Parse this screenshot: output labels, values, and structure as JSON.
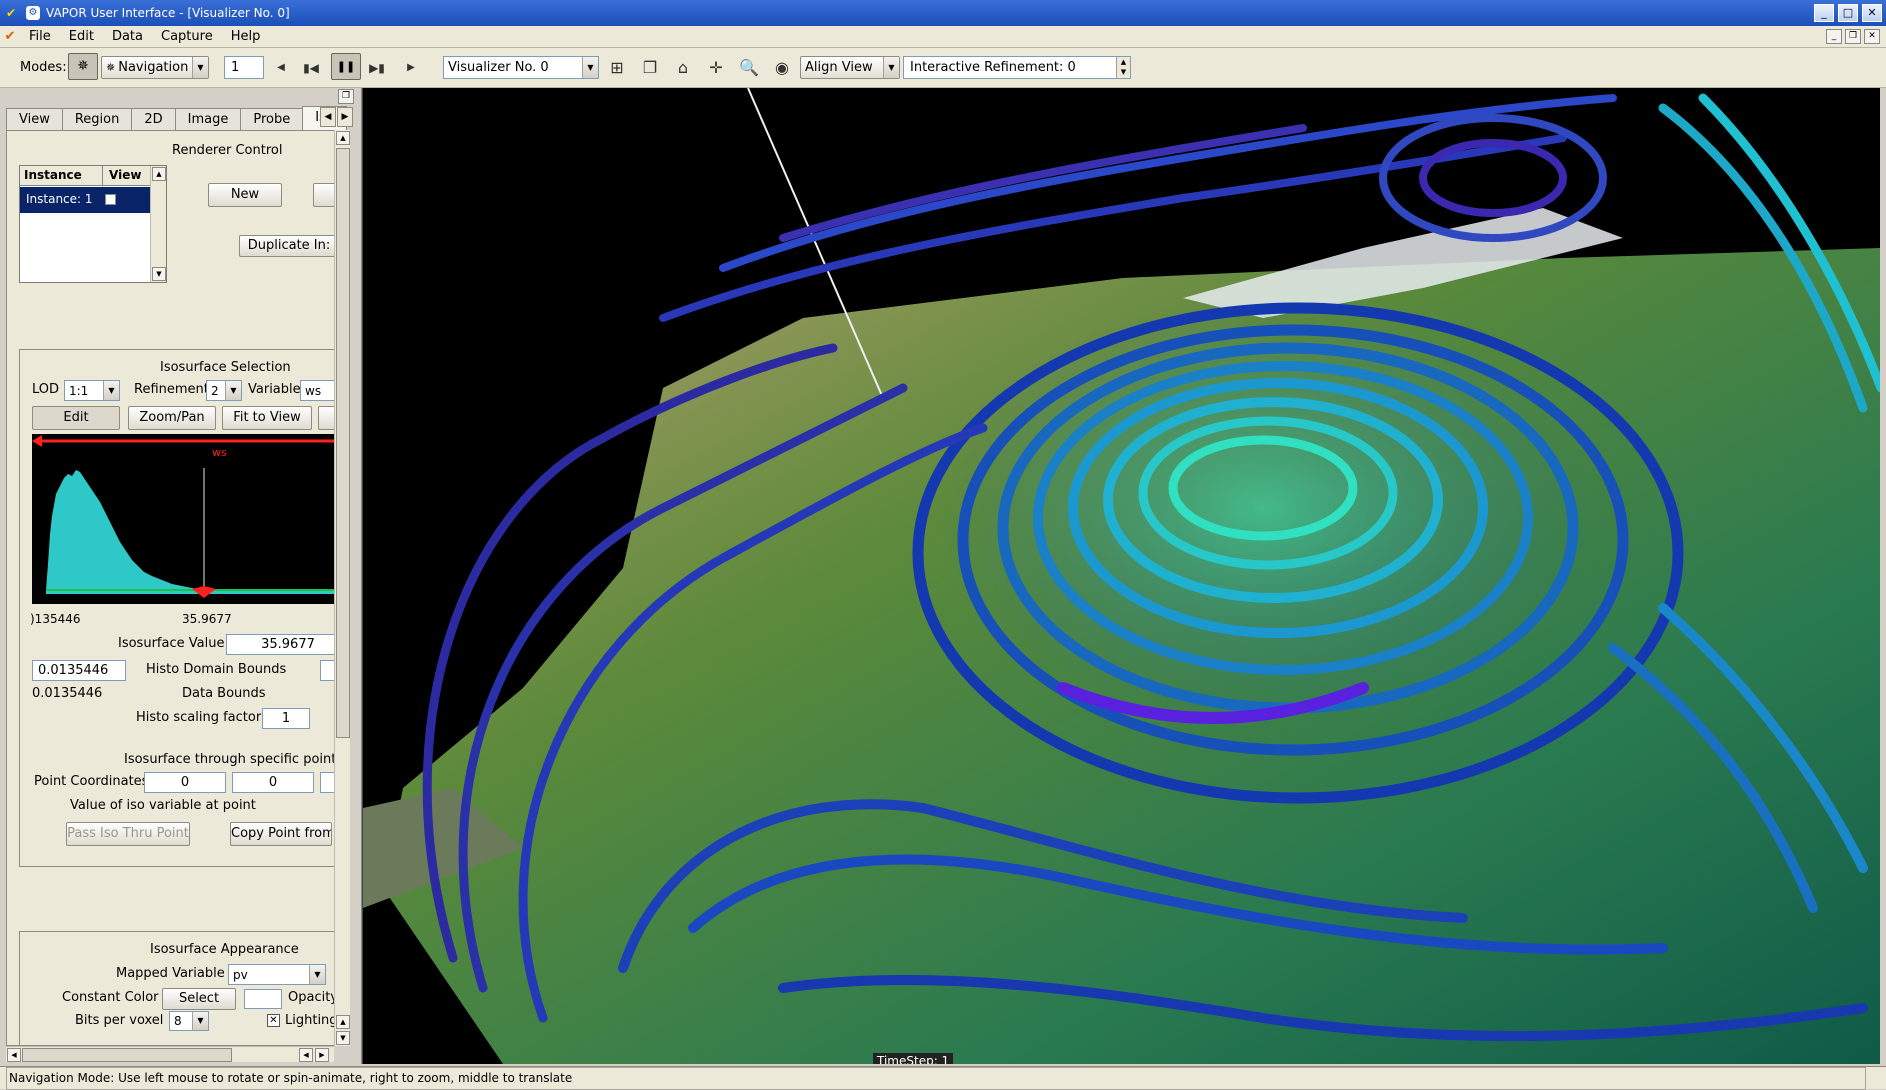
{
  "window": {
    "title": "VAPOR User Interface - [Visualizer No. 0]"
  },
  "menu": {
    "items": [
      "File",
      "Edit",
      "Data",
      "Capture",
      "Help"
    ]
  },
  "toolbar": {
    "modes_label": "Modes:",
    "mode_value": "Navigation",
    "frame_value": "1",
    "visualizer_value": "Visualizer No. 0",
    "align_view_value": "Align View",
    "refinement_value": "Interactive Refinement: 0"
  },
  "tabs": [
    "View",
    "Region",
    "2D",
    "Image",
    "Probe",
    "Iso"
  ],
  "renderer_control": {
    "title": "Renderer Control",
    "col_instance": "Instance",
    "col_view": "View",
    "instance_row": "Instance: 1",
    "new_button": "New",
    "duplicate_button": "Duplicate In:"
  },
  "iso_selection": {
    "title": "Isosurface Selection",
    "lod_label": "LOD",
    "lod_value": "1:1",
    "refinement_label": "Refinement",
    "refinement_value": "2",
    "variable_label": "Variable",
    "variable_value": "ws",
    "edit_button": "Edit",
    "zoompan_button": "Zoom/Pan",
    "fit_button": "Fit to View",
    "histo_var": "ws",
    "histo_min_label": ")135446",
    "histo_iso_label": "35.9677",
    "iso_value_label": "Isosurface Value",
    "iso_value": "35.9677",
    "domain_min": "0.0135446",
    "domain_bounds_label": "Histo Domain Bounds",
    "data_min": "0.0135446",
    "data_bounds_label": "Data Bounds",
    "scaling_label": "Histo scaling factor",
    "scaling_value": "1",
    "point_title": "Isosurface through specific point",
    "point_label": "Point Coordinates",
    "point_x": "0",
    "point_y": "0",
    "value_at_point_label": "Value of iso variable at point",
    "pass_button": "Pass Iso Thru Point",
    "copy_button": "Copy Point from"
  },
  "iso_appearance": {
    "title": "Isosurface Appearance",
    "mapped_label": "Mapped Variable",
    "mapped_value": "pv",
    "constant_color_label": "Constant Color",
    "select_button": "Select",
    "opacity_label": "Opacity:",
    "bits_label": "Bits per voxel",
    "bits_value": "8",
    "lighting_label": "Lighting"
  },
  "viewport": {
    "timestep": "TimeStep: 1"
  },
  "status": {
    "text": "Navigation Mode:  Use left mouse to rotate or spin-animate, right to zoom, middle to translate"
  },
  "colors": {
    "titlebar": "#1c4fb8",
    "selection": "#0a246a",
    "histogram": "#2ec8c8",
    "marker": "#ff2020"
  }
}
